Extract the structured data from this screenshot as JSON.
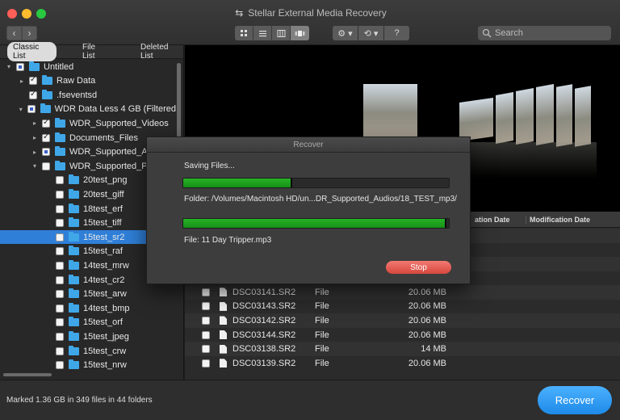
{
  "window": {
    "title": "Stellar External Media Recovery"
  },
  "toolbar": {
    "back": "‹",
    "forward": "›",
    "settings_glyph": "⚙ ▾",
    "history_glyph": "⟲ ▾",
    "help": "?",
    "search_placeholder": "Search",
    "view_modes": [
      "grid-view-icon",
      "list-view-icon",
      "column-view-icon",
      "coverflow-view-icon"
    ],
    "active_view": "coverflow-view-icon"
  },
  "sidebar": {
    "tabs": [
      "Classic List",
      "File List",
      "Deleted List"
    ],
    "active_tab": "Classic List",
    "tree": [
      {
        "label": "Untitled",
        "level": 0,
        "disclosure": "▾",
        "check": "partial"
      },
      {
        "label": "Raw Data",
        "level": 1,
        "disclosure": "▸",
        "check": "checked"
      },
      {
        "label": ".fseventsd",
        "level": 1,
        "disclosure": "",
        "check": "checked"
      },
      {
        "label": "WDR Data Less 4 GB (Filtered",
        "level": 1,
        "disclosure": "▾",
        "check": "partial"
      },
      {
        "label": "WDR_Supported_Videos",
        "level": 2,
        "disclosure": "▸",
        "check": "checked"
      },
      {
        "label": "Documents_Files",
        "level": 2,
        "disclosure": "▸",
        "check": "checked"
      },
      {
        "label": "WDR_Supported_A",
        "level": 2,
        "disclosure": "▸",
        "check": "partial"
      },
      {
        "label": "WDR_Supported_P",
        "level": 2,
        "disclosure": "▾",
        "check": "unchecked"
      },
      {
        "label": "20test_png",
        "level": 3,
        "disclosure": "",
        "check": "unchecked"
      },
      {
        "label": "20test_giff",
        "level": 3,
        "disclosure": "",
        "check": "unchecked"
      },
      {
        "label": "18test_erf",
        "level": 3,
        "disclosure": "",
        "check": "unchecked"
      },
      {
        "label": "15test_tiff",
        "level": 3,
        "disclosure": "",
        "check": "unchecked"
      },
      {
        "label": "15test_sr2",
        "level": 3,
        "disclosure": "",
        "check": "unchecked",
        "selected": true
      },
      {
        "label": "15test_raf",
        "level": 3,
        "disclosure": "",
        "check": "unchecked"
      },
      {
        "label": "14test_mrw",
        "level": 3,
        "disclosure": "",
        "check": "unchecked"
      },
      {
        "label": "14test_cr2",
        "level": 3,
        "disclosure": "",
        "check": "unchecked"
      },
      {
        "label": "15test_arw",
        "level": 3,
        "disclosure": "",
        "check": "unchecked"
      },
      {
        "label": "14test_bmp",
        "level": 3,
        "disclosure": "",
        "check": "unchecked"
      },
      {
        "label": "15test_orf",
        "level": 3,
        "disclosure": "",
        "check": "unchecked"
      },
      {
        "label": "15test_jpeg",
        "level": 3,
        "disclosure": "",
        "check": "unchecked"
      },
      {
        "label": "15test_crw",
        "level": 3,
        "disclosure": "",
        "check": "unchecked"
      },
      {
        "label": "15test_nrw",
        "level": 3,
        "disclosure": "",
        "check": "unchecked"
      }
    ]
  },
  "table": {
    "headers": {
      "creation": "ation Date",
      "modification": "Modification Date"
    },
    "rows": [
      {
        "name": "DSC03141.SR2",
        "type": "File",
        "size": "20.06 MB"
      },
      {
        "name": "DSC03143.SR2",
        "type": "File",
        "size": "20.06 MB"
      },
      {
        "name": "DSC03142.SR2",
        "type": "File",
        "size": "20.06 MB"
      },
      {
        "name": "DSC03144.SR2",
        "type": "File",
        "size": "20.06 MB"
      },
      {
        "name": "DSC03138.SR2",
        "type": "File",
        "size": "14  MB"
      },
      {
        "name": "DSC03139.SR2",
        "type": "File",
        "size": "20.06 MB"
      }
    ]
  },
  "dialog": {
    "title": "Recover",
    "saving_label": "Saving Files...",
    "folder_label": "Folder: /Volumes/Macintosh HD/un...DR_Supported_Audios/18_TEST_mp3/",
    "file_label": "File: 11 Day Tripper.mp3",
    "overall_progress": 0.41,
    "file_progress": 0.99,
    "stop_label": "Stop"
  },
  "status": {
    "summary": "Marked 1.36 GB in 349 files in 44 folders",
    "recover_label": "Recover"
  },
  "colors": {
    "accent": "#2f7fd8",
    "progress": "#1fa31f",
    "stop": "#e05a52",
    "recover": "#2a95f0"
  }
}
